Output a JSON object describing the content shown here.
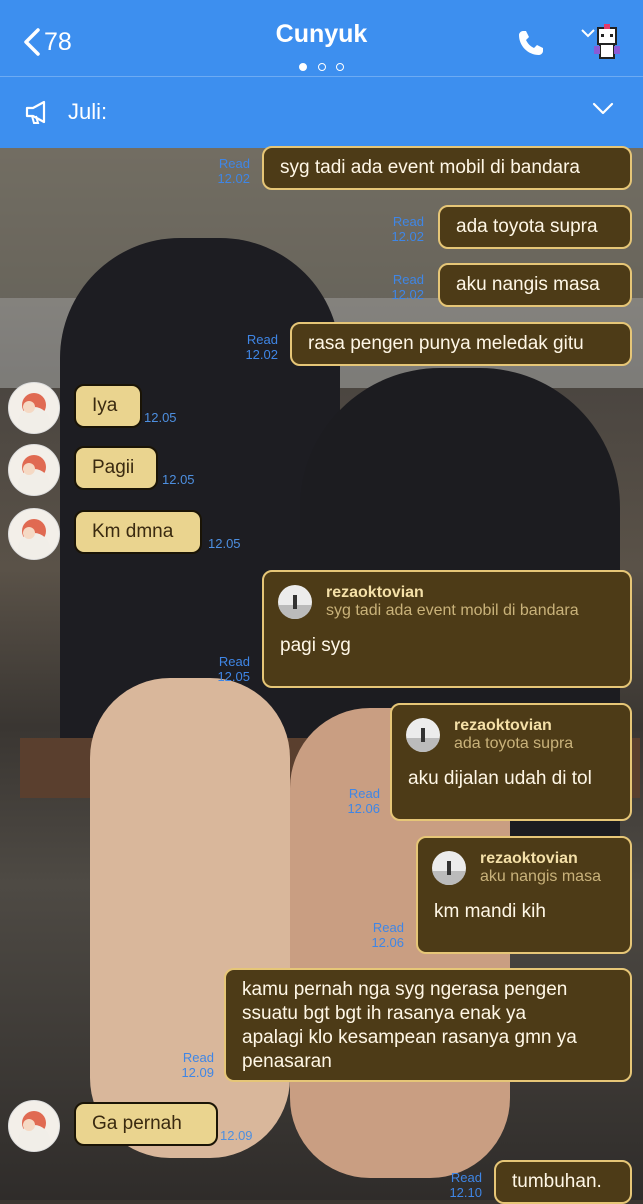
{
  "header": {
    "back_count": "78",
    "title": "Cunyuk",
    "accent": "#3d8fef"
  },
  "announcement": {
    "text": "Juli:"
  },
  "messages": {
    "m1": {
      "text": "syg tadi ada event mobil di bandara",
      "read": "Read",
      "time": "12.02"
    },
    "m2": {
      "text": "ada toyota supra",
      "read": "Read",
      "time": "12.02"
    },
    "m3": {
      "text": "aku nangis masa",
      "read": "Read",
      "time": "12.02"
    },
    "m4": {
      "text": "rasa pengen punya meledak gitu",
      "read": "Read",
      "time": "12.02"
    },
    "r1": {
      "text": "Iya",
      "time": "12.05"
    },
    "r2": {
      "text": "Pagii",
      "time": "12.05"
    },
    "r3": {
      "text": "Km dmna",
      "time": "12.05"
    },
    "m5": {
      "reply_name": "rezaoktovian",
      "reply_quote": "syg tadi ada event mobil di bandara",
      "text": "pagi syg",
      "read": "Read",
      "time": "12.05"
    },
    "m6": {
      "reply_name": "rezaoktovian",
      "reply_quote": "ada toyota supra",
      "text": "aku dijalan udah di tol",
      "read": "Read",
      "time": "12.06"
    },
    "m7": {
      "reply_name": "rezaoktovian",
      "reply_quote": "aku nangis masa",
      "text": "km mandi kih",
      "read": "Read",
      "time": "12.06"
    },
    "m8": {
      "text": "kamu pernah nga syg ngerasa pengen\nssuatu bgt bgt ih rasanya enak ya\napalagi klo kesampean rasanya gmn ya\npenasaran",
      "read": "Read",
      "time": "12.09"
    },
    "r4": {
      "text": "Ga pernah",
      "time": "12.09"
    },
    "m9": {
      "text": "tumbuhan.",
      "read": "Read",
      "time": "12.10"
    }
  }
}
